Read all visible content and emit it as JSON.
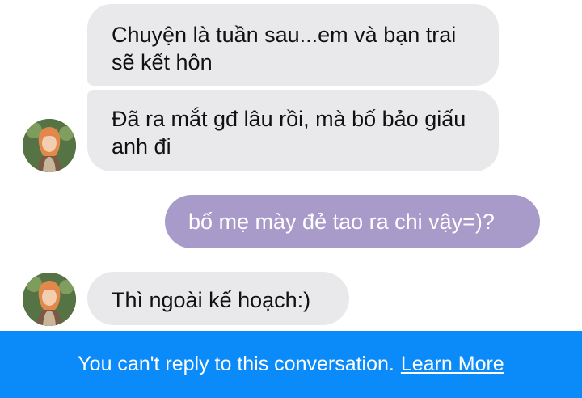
{
  "messages": [
    {
      "direction": "incoming",
      "text": "Chuyện là tuần sau...em và bạn trai sẽ kết hôn"
    },
    {
      "direction": "incoming",
      "text": "Đã ra mắt gđ lâu rồi, mà bố bảo giấu anh đi"
    },
    {
      "direction": "outgoing",
      "text": "bố mẹ mày đẻ tao ra chi vậy=)?"
    },
    {
      "direction": "incoming",
      "text": "Thì ngoài kế hoạch:)"
    }
  ],
  "footer": {
    "notice": "You can't reply to this conversation.",
    "link_label": "Learn More"
  },
  "colors": {
    "incoming_bubble": "#e9e9eb",
    "outgoing_bubble": "#a89ac9",
    "footer_background": "#0a8bf9"
  },
  "icons": {
    "contact_avatar": "profile-photo"
  }
}
